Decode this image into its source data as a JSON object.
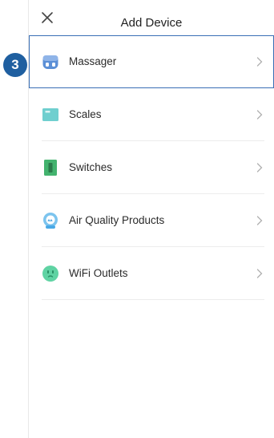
{
  "header": {
    "title": "Add Device",
    "close_icon": "close-icon"
  },
  "step_badge": "3",
  "accent_color": "#1f5fa0",
  "devices": [
    {
      "label": "Massager",
      "icon": "massager-icon",
      "highlighted": true
    },
    {
      "label": "Scales",
      "icon": "scale-icon"
    },
    {
      "label": "Switches",
      "icon": "switch-icon"
    },
    {
      "label": "Air Quality Products",
      "icon": "air-purifier-icon"
    },
    {
      "label": "WiFi Outlets",
      "icon": "outlet-icon"
    }
  ]
}
